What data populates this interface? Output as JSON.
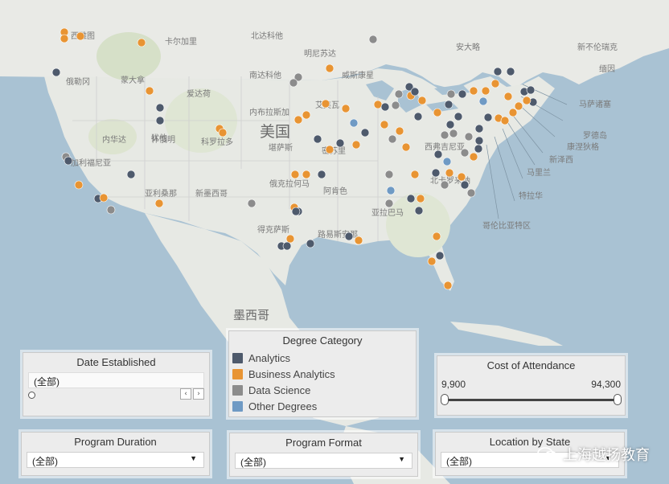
{
  "map": {
    "country_label": "美国",
    "mexico_label": "墨西哥",
    "place_labels": [
      {
        "id": "seattle",
        "text": "西雅图"
      },
      {
        "id": "calgary",
        "text": "卡尔加里"
      },
      {
        "id": "north_dakota",
        "text": "北达科他"
      },
      {
        "id": "minnesota",
        "text": "明尼苏达"
      },
      {
        "id": "spokane",
        "text": "俄勒冈"
      },
      {
        "id": "montana",
        "text": "蒙大拿"
      },
      {
        "id": "idaho",
        "text": "爱达荷"
      },
      {
        "id": "south_dakota",
        "text": "南达科他"
      },
      {
        "id": "wisconsin",
        "text": "威斯康星"
      },
      {
        "id": "wyoming",
        "text": "怀俄明"
      },
      {
        "id": "nebraska",
        "text": "内布拉斯加"
      },
      {
        "id": "iowa",
        "text": "艾奥瓦"
      },
      {
        "id": "nevada",
        "text": "内华达"
      },
      {
        "id": "utah",
        "text": "犹他"
      },
      {
        "id": "colorado",
        "text": "科罗拉多"
      },
      {
        "id": "kansas",
        "text": "堪萨斯"
      },
      {
        "id": "missouri",
        "text": "密苏里"
      },
      {
        "id": "california",
        "text": "加利福尼亚"
      },
      {
        "id": "arizona",
        "text": "亚利桑那"
      },
      {
        "id": "new_mexico",
        "text": "新墨西哥"
      },
      {
        "id": "oklahoma",
        "text": "俄克拉何马"
      },
      {
        "id": "arkansas",
        "text": "阿肯色"
      },
      {
        "id": "texas",
        "text": "得克萨斯"
      },
      {
        "id": "louisiana",
        "text": "路易斯安那"
      },
      {
        "id": "alabama",
        "text": "亚拉巴马"
      },
      {
        "id": "north_carolina",
        "text": "北卡罗来纳"
      },
      {
        "id": "west_virginia",
        "text": "西弗吉尼亚"
      },
      {
        "id": "ontario",
        "text": "安大略"
      },
      {
        "id": "new_brunswick",
        "text": "新不伦瑞克"
      },
      {
        "id": "maine",
        "text": "缅因"
      },
      {
        "id": "massachusetts",
        "text": "马萨诸塞"
      },
      {
        "id": "rhode_island",
        "text": "罗德岛"
      },
      {
        "id": "connecticut",
        "text": "康涅狄格"
      },
      {
        "id": "new_jersey",
        "text": "新泽西"
      },
      {
        "id": "maryland",
        "text": "马里兰"
      },
      {
        "id": "delaware",
        "text": "特拉华"
      },
      {
        "id": "dc",
        "text": "哥伦比亚特区"
      }
    ]
  },
  "panels": {
    "date_established": {
      "title": "Date Established",
      "value": "(全部)"
    },
    "program_duration": {
      "title": "Program Duration",
      "value": "(全部)"
    },
    "program_format": {
      "title": "Program Format",
      "value": "(全部)"
    },
    "location_by_state": {
      "title": "Location by State",
      "value": "(全部)"
    },
    "cost": {
      "title": "Cost of Attendance",
      "min": "9,900",
      "max": "94,300"
    },
    "legend": {
      "title": "Degree Category",
      "items": [
        {
          "label": "Analytics",
          "color": "#4e5a6c"
        },
        {
          "label": "Business Analytics",
          "color": "#e89433"
        },
        {
          "label": "Data Science",
          "color": "#8c8c8c"
        },
        {
          "label": "Other Degrees",
          "color": "#6f9ac4"
        }
      ]
    }
  },
  "colors": {
    "land": "#e7e9e4",
    "water": "#a9c2d3",
    "analytics": "#4e5a6c",
    "business": "#e89433",
    "datascience": "#8c8c8c",
    "other": "#6f9ac4"
  },
  "watermark": "上海越扬教育"
}
